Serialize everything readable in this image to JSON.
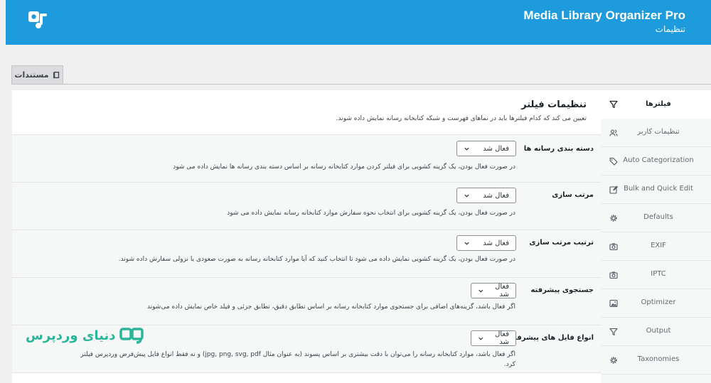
{
  "header": {
    "title": "Media Library Organizer Pro",
    "subtitle": "تنظیمات",
    "color": "#1e9bdc"
  },
  "doc_tab": {
    "label": "مستندات",
    "icon": "book-icon"
  },
  "sidebar": {
    "items": [
      {
        "label": "فیلترها",
        "icon": "filter-icon",
        "active": true
      },
      {
        "label": "تنظیمات کاربر",
        "icon": "users-icon"
      },
      {
        "label": "Auto Categorization",
        "icon": "tag-icon"
      },
      {
        "label": "Bulk and Quick Edit",
        "icon": "edit-icon"
      },
      {
        "label": "Defaults",
        "icon": "gear-icon"
      },
      {
        "label": "EXIF",
        "icon": "camera-icon"
      },
      {
        "label": "IPTC",
        "icon": "camera-icon"
      },
      {
        "label": "Optimizer",
        "icon": "image-icon"
      },
      {
        "label": "Output",
        "icon": "filter-icon"
      },
      {
        "label": "Taxonomies",
        "icon": "gear-icon"
      }
    ]
  },
  "section": {
    "title": "تنظیمات فیلتر",
    "description": "تعیین می کند که کدام فیلترها باید در نماهای فهرست و شبکه کتابخانه رسانه نمایش داده شوند."
  },
  "rows": [
    {
      "label": "دسته بندی رسانه ها",
      "select_value": "فعال شد",
      "description": "در صورت فعال بودن، یک گزینه کشویی برای فیلتر کردن موارد کتابخانه رسانه بر اساس دسته بندی رسانه ها نمایش داده می شود"
    },
    {
      "label": "مرتب سازی",
      "select_value": "فعال شد",
      "description": "در صورت فعال بودن، یک گزینه کشویی برای انتخاب نحوه سفارش موارد کتابخانه رسانه نمایش داده می شود"
    },
    {
      "label": "ترتیب مرتب سازی",
      "select_value": "فعال شد",
      "description": "در صورت فعال بودن، یک گزینه کشویی نمایش داده می شود تا انتخاب کنید که آیا موارد کتابخانه رسانه به صورت صعودی یا نزولی سفارش داده شوند."
    },
    {
      "label": "جستجوی پیشرفته",
      "select_value": "فعال شد",
      "description": "اگر فعال باشد، گزینه‌های اضافی برای جستجوی موارد کتابخانه رسانه بر اساس تطابق دقیق، تطابق جزئی و فیلد خاص نمایش داده می‌شوند"
    },
    {
      "label": "انواع فایل های پیشرفته",
      "select_value": "فعال شد",
      "description": "اگر فعال باشد، موارد کتابخانه رسانه را می‌توان با دقت بیشتری بر اساس پسوند (به عنوان مثال jpg, png, svg, pdf) و نه فقط انواع فایل پیش‌فرض وردپرس فیلتر کرد."
    }
  ],
  "watermark": {
    "text": "دنیای وردپرس",
    "color": "#2bb59a"
  }
}
